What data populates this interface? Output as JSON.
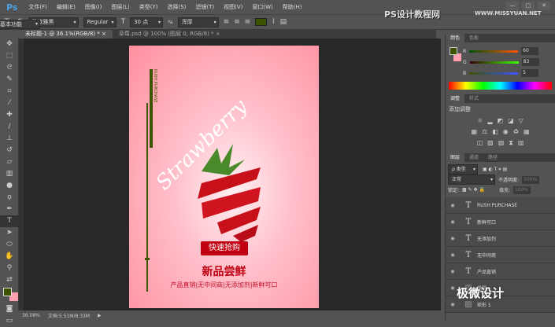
{
  "app": {
    "logo": "Ps",
    "menus": [
      "文件(F)",
      "编辑(E)",
      "图像(I)",
      "图层(L)",
      "类型(Y)",
      "选择(S)",
      "滤镜(T)",
      "视图(V)",
      "窗口(W)",
      "帮助(H)"
    ],
    "window_buttons": [
      "—",
      "▢",
      "✕"
    ]
  },
  "options": {
    "font_family": "微软雅黑",
    "font_style": "Regular",
    "font_size": "30 点",
    "antialias": "浑厚",
    "text_color": "#3c5300"
  },
  "site_watermark": {
    "name": "PS设计教程网",
    "url": "WWW.MISSYUAN.NET"
  },
  "workspace": "基本功能",
  "tabs": [
    {
      "label": "未标题-1 @ 36.1%(RGB/8) *",
      "close": "×"
    },
    {
      "label": "草莓.psd @ 100% (图层 0, RGB/8) *",
      "close": "×"
    }
  ],
  "poster": {
    "rush": "RUSH PURCHASE",
    "title_script": "Strawberry",
    "button": "快速抢购",
    "headline": "新品尝鲜",
    "features": "产品直销|无中间商|无添加剂|新鲜可口",
    "bg_color": "#ff8f9f",
    "accent": "#c00010"
  },
  "status": {
    "zoom": "36.08%",
    "doc": "文档:5.51M/8.33M"
  },
  "color_panel": {
    "tabs": [
      "颜色",
      "色板"
    ],
    "R": 60,
    "G": 83,
    "B": 5,
    "labels": [
      "R",
      "G",
      "B"
    ]
  },
  "adjust_panel": {
    "tabs": [
      "调整",
      "样式"
    ],
    "title": "添加调整"
  },
  "layers_panel": {
    "tabs": [
      "图层",
      "通道",
      "路径"
    ],
    "filter": "ρ 类型",
    "blend": "正常",
    "opacity_label": "不透明度:",
    "opacity": "100%",
    "lock_label": "锁定:",
    "fill_label": "填充:",
    "fill": "100%",
    "layers": [
      "RUSH PURCHASE",
      "新鲜可口",
      "无添加剂",
      "无中间商",
      "产品直销",
      "椭圆",
      "矩形 1"
    ]
  },
  "overlay_watermark": "极微设计"
}
